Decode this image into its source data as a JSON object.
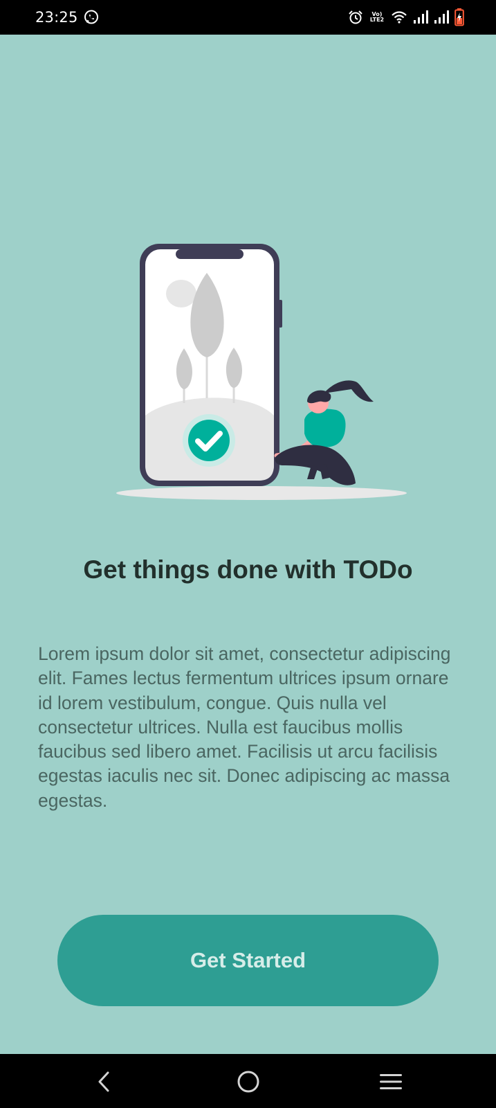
{
  "status_bar": {
    "time": "23:25",
    "network_label": "Vo) LTE2",
    "icons": [
      "whatsapp-icon",
      "alarm-icon",
      "volte-icon",
      "wifi-icon",
      "signal-icon",
      "signal-icon",
      "battery-charging-icon"
    ]
  },
  "onboarding": {
    "title": "Get things done with TODo",
    "description": "Lorem ipsum dolor sit amet, consectetur adipiscing elit. Fames lectus fermentum ultrices ipsum ornare id lorem vestibulum, congue. Quis nulla vel consectetur ultrices. Nulla est faucibus mollis faucibus sed libero amet. Facilisis ut arcu facilisis egestas iaculis nec sit. Donec adipiscing ac massa egestas.",
    "button_label": "Get Started"
  },
  "navigation": {
    "icons": [
      "back-icon",
      "home-icon",
      "recents-icon"
    ]
  },
  "colors": {
    "background": "#9ed0c9",
    "button": "#2e9e93",
    "button_text": "#d6ede9",
    "accent_green": "#00b09b",
    "title_text": "#22302c",
    "body_text": "#4a6661"
  }
}
